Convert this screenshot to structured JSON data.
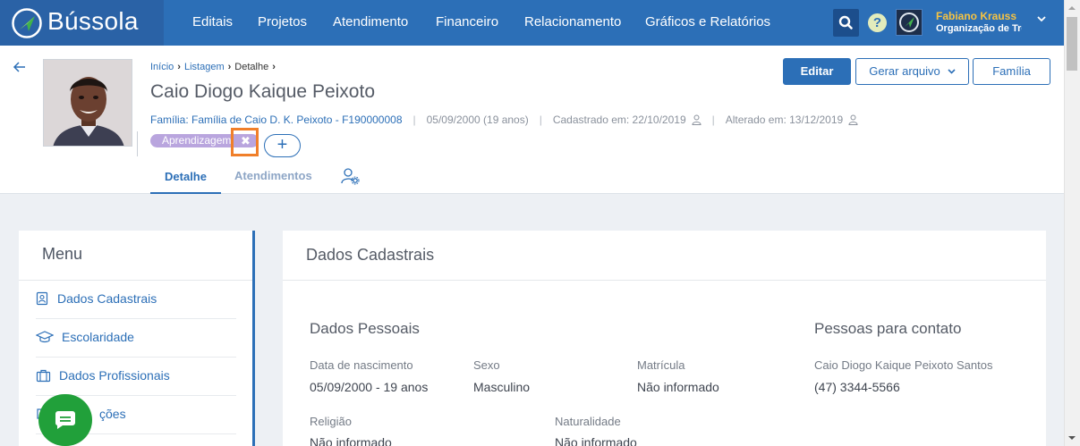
{
  "app": {
    "brand": "Bússola"
  },
  "nav": {
    "items": [
      "Editais",
      "Projetos",
      "Atendimento",
      "Financeiro",
      "Relacionamento",
      "Gráficos e Relatórios"
    ]
  },
  "user": {
    "name": "Fabiano Krauss",
    "org": "Organização de Tre"
  },
  "breadcrumb": {
    "home": "Início",
    "list": "Listagem",
    "current": "Detalhe"
  },
  "person": {
    "name": "Caio Diogo Kaique Peixoto",
    "family_label": "Família:",
    "family_link": "Família de Caio D. K. Peixoto - F190000008",
    "birth": "05/09/2000 (19 anos)",
    "created": "Cadastrado em: 22/10/2019",
    "updated": "Alterado em: 13/12/2019",
    "tag": "Aprendizagem"
  },
  "actions": {
    "edit": "Editar",
    "generate": "Gerar arquivo",
    "family": "Família"
  },
  "tabs": {
    "detail": "Detalhe",
    "attendances": "Atendimentos"
  },
  "menu": {
    "title": "Menu",
    "items": [
      "Dados Cadastrais",
      "Escolaridade",
      "Dados Profissionais",
      "ções"
    ]
  },
  "card": {
    "title": "Dados Cadastrais",
    "personal": {
      "title": "Dados Pessoais",
      "birth_label": "Data de nascimento",
      "birth_value": "05/09/2000 - 19 anos",
      "sex_label": "Sexo",
      "sex_value": "Masculino",
      "enroll_label": "Matrícula",
      "enroll_value": "Não informado",
      "religion_label": "Religião",
      "religion_value": "Não informado",
      "nat_label": "Naturalidade",
      "nat_value": "Não informado"
    },
    "contacts": {
      "title": "Pessoas para contato",
      "name": "Caio Diogo Kaique Peixoto Santos",
      "phone": "(47) 3344-5566"
    }
  },
  "colors": {
    "primary": "#2c6fb7",
    "brand_bg": "#2a62a6",
    "tag": "#b9a5de",
    "highlight": "#f07f2a",
    "chat": "#21a03a"
  }
}
